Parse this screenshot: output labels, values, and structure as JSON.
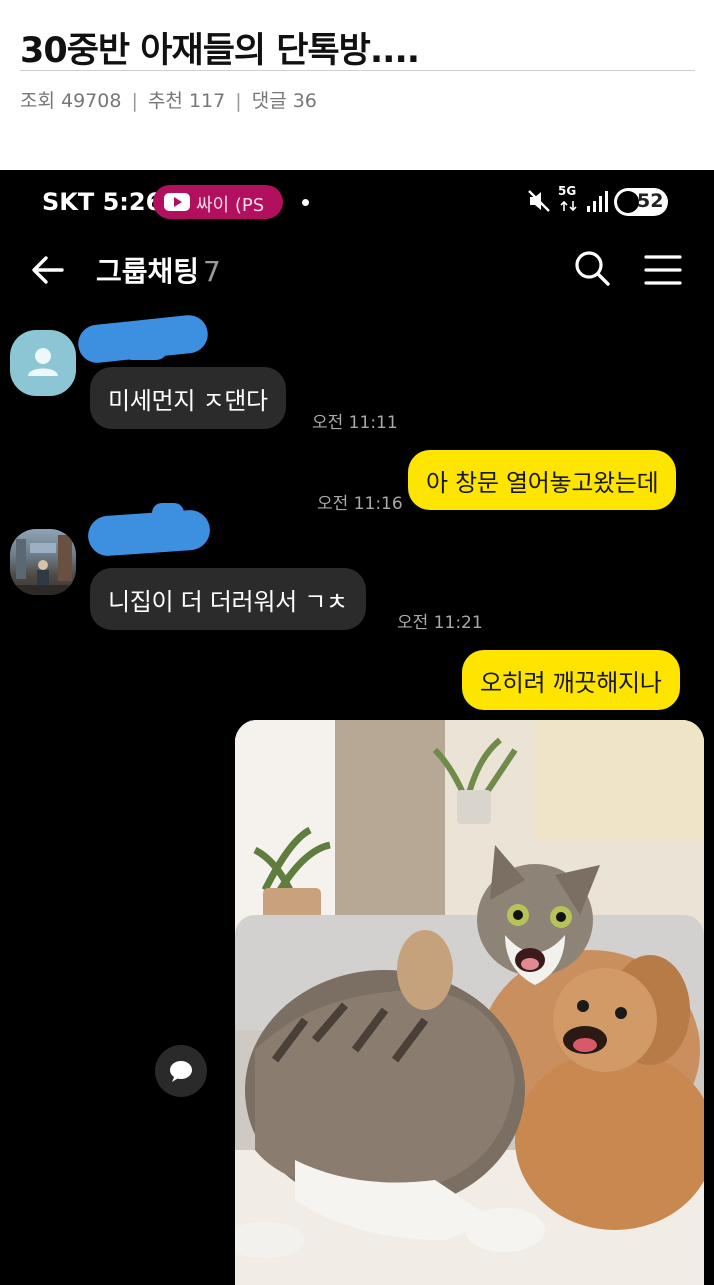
{
  "post": {
    "title": "30중반 아재들의 단톡방....",
    "views_label": "조회 49708",
    "recommends_label": "추천 117",
    "comments_label": "댓글 36",
    "separator": "|"
  },
  "status_bar": {
    "carrier_time": "SKT 5:26",
    "media_pill": "싸이 (PS",
    "network": "5G",
    "battery": "52",
    "pill_color": "#b0105e"
  },
  "chat": {
    "title": "그룹채팅",
    "member_count": "7",
    "messages": [
      {
        "side": "in",
        "text": "미세먼지 ㅈ댄다",
        "time": "오전 11:11"
      },
      {
        "side": "out",
        "text": "아 창문 열어놓고왔는데",
        "time": "오전 11:16"
      },
      {
        "side": "in",
        "text": "니집이 더 더러워서 ㄱㅊ",
        "time": "오전 11:21"
      },
      {
        "side": "out",
        "text": "오히려 깨끗해지나",
        "time": ""
      }
    ],
    "photo_message": "cat-hugging-dog-photo"
  },
  "colors": {
    "outgoing_bubble": "#fee500",
    "incoming_bubble": "#2b2b2b",
    "background": "#000000",
    "name_redaction": "#3d8fe0"
  }
}
